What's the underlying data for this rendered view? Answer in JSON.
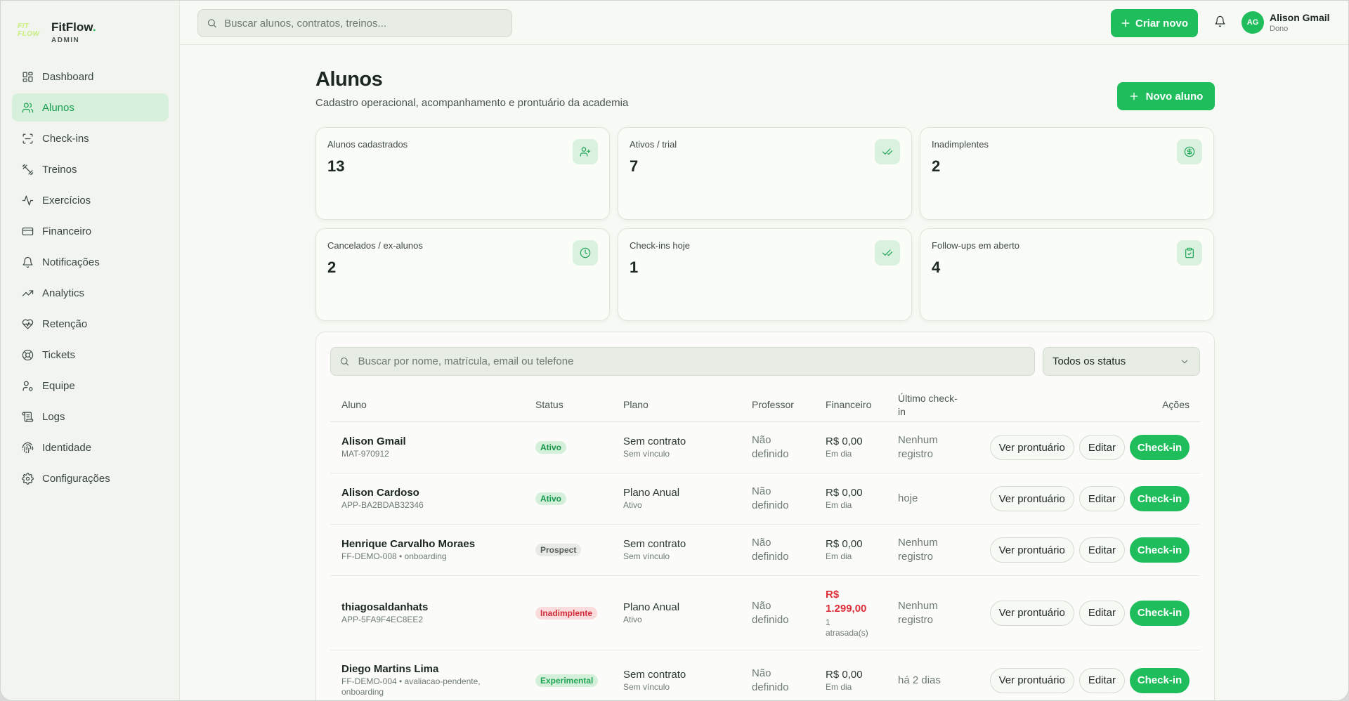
{
  "brand": {
    "logo_text": "FIT FLOW",
    "name": "FitFlow",
    "dot": ".",
    "subtitle": "ADMIN"
  },
  "sidebar": {
    "items": [
      {
        "label": "Dashboard",
        "icon": "dashboard-icon"
      },
      {
        "label": "Alunos",
        "icon": "users-icon",
        "active": true
      },
      {
        "label": "Check-ins",
        "icon": "scan-icon"
      },
      {
        "label": "Treinos",
        "icon": "dumbbell-icon"
      },
      {
        "label": "Exercícios",
        "icon": "activity-icon"
      },
      {
        "label": "Financeiro",
        "icon": "credit-card-icon"
      },
      {
        "label": "Notificações",
        "icon": "bell-icon"
      },
      {
        "label": "Analytics",
        "icon": "trending-up-icon"
      },
      {
        "label": "Retenção",
        "icon": "heart-pulse-icon"
      },
      {
        "label": "Tickets",
        "icon": "life-buoy-icon"
      },
      {
        "label": "Equipe",
        "icon": "user-cog-icon"
      },
      {
        "label": "Logs",
        "icon": "scroll-icon"
      },
      {
        "label": "Identidade",
        "icon": "fingerprint-icon"
      },
      {
        "label": "Configurações",
        "icon": "settings-icon"
      }
    ]
  },
  "topbar": {
    "search_placeholder": "Buscar alunos, contratos, treinos...",
    "create_label": "Criar novo",
    "user": {
      "initials": "AG",
      "name": "Alison Gmail",
      "role": "Dono"
    }
  },
  "page": {
    "title": "Alunos",
    "subtitle": "Cadastro operacional, acompanhamento e prontuário da academia",
    "new_button": "Novo aluno"
  },
  "stats": [
    {
      "label": "Alunos cadastrados",
      "value": "13",
      "icon": "user-plus-icon"
    },
    {
      "label": "Ativos / trial",
      "value": "7",
      "icon": "check-check-icon"
    },
    {
      "label": "Inadimplentes",
      "value": "2",
      "icon": "dollar-circle-icon"
    },
    {
      "label": "Cancelados / ex-alunos",
      "value": "2",
      "icon": "clock-icon"
    },
    {
      "label": "Check-ins hoje",
      "value": "1",
      "icon": "check-check-icon"
    },
    {
      "label": "Follow-ups em aberto",
      "value": "4",
      "icon": "clipboard-icon"
    }
  ],
  "table": {
    "search_placeholder": "Buscar por nome, matrícula, email ou telefone",
    "status_filter": "Todos os status",
    "headers": {
      "aluno": "Aluno",
      "status": "Status",
      "plano": "Plano",
      "professor": "Professor",
      "financeiro": "Financeiro",
      "checkin": "Último check-in",
      "acoes": "Ações"
    },
    "action_labels": {
      "view": "Ver prontuário",
      "edit": "Editar",
      "checkin": "Check-in"
    },
    "rows": [
      {
        "name": "Alison Gmail",
        "id": "MAT-970912",
        "status": "Ativo",
        "plan": "Sem contrato",
        "plan_sub": "Sem vínculo",
        "professor": "Não definido",
        "fin": "R$ 0,00",
        "fin_sub": "Em dia",
        "checkin": "Nenhum registro"
      },
      {
        "name": "Alison Cardoso",
        "id": "APP-BA2BDAB32346",
        "status": "Ativo",
        "plan": "Plano Anual",
        "plan_sub": "Ativo",
        "professor": "Não definido",
        "fin": "R$ 0,00",
        "fin_sub": "Em dia",
        "checkin": "hoje"
      },
      {
        "name": "Henrique Carvalho Moraes",
        "id": "FF-DEMO-008 • onboarding",
        "status": "Prospect",
        "plan": "Sem contrato",
        "plan_sub": "Sem vínculo",
        "professor": "Não definido",
        "fin": "R$ 0,00",
        "fin_sub": "Em dia",
        "checkin": "Nenhum registro"
      },
      {
        "name": "thiagosaldanhats",
        "id": "APP-5FA9F4EC8EE2",
        "status": "Inadimplente",
        "plan": "Plano Anual",
        "plan_sub": "Ativo",
        "professor": "Não definido",
        "fin": "R$ 1.299,00",
        "fin_sub": "1 atrasada(s)",
        "checkin": "Nenhum registro"
      },
      {
        "name": "Diego Martins Lima",
        "id": "FF-DEMO-004 • avaliacao-pendente, onboarding",
        "status": "Experimental",
        "plan": "Sem contrato",
        "plan_sub": "Sem vínculo",
        "professor": "Não definido",
        "fin": "R$ 0,00",
        "fin_sub": "Em dia",
        "checkin": "há 2 dias"
      }
    ]
  },
  "colors": {
    "accent": "#1fbd5c",
    "danger": "#dc2f3a",
    "background": "#f7f9f5",
    "sidebar": "#f1f4ef"
  }
}
